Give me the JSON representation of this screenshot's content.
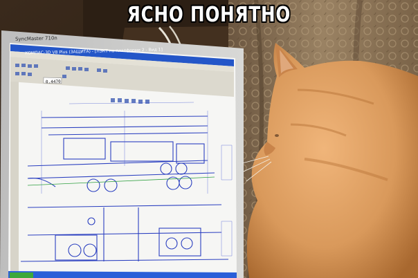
{
  "caption": "ЯСНО ПОНЯТНО",
  "monitor": {
    "brand": "SyncMaster 710n",
    "app_title": "КОМПАС-3D V8 Plus (ЗАЩИТА) - [ЛЭКТ на платформе 2 - Вид 1]",
    "zoom": "0.4470"
  },
  "colors": {
    "caption_fill": "#ffffff",
    "caption_outline": "#000000",
    "titlebar": "#2456c8",
    "drawing_lines": "#2a3fc0",
    "cat_fur": "#d99a5c",
    "curtain": "#8a7356"
  },
  "icons": [
    "monitor-bezel",
    "toolbar-icons",
    "cat-silhouette"
  ]
}
